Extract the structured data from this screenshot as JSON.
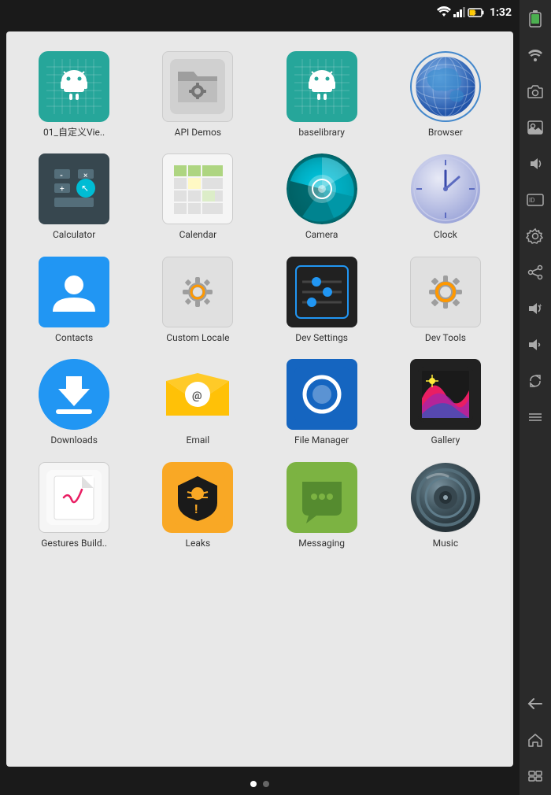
{
  "statusBar": {
    "time": "1:32",
    "wifiIcon": "wifi",
    "signalIcon": "signal",
    "batteryIcon": "battery"
  },
  "apps": [
    {
      "id": "app-01view",
      "label": "01_自定义Vie..",
      "iconType": "01view"
    },
    {
      "id": "app-api",
      "label": "API Demos",
      "iconType": "api"
    },
    {
      "id": "app-base",
      "label": "baselibrary",
      "iconType": "base"
    },
    {
      "id": "app-browser",
      "label": "Browser",
      "iconType": "browser"
    },
    {
      "id": "app-calculator",
      "label": "Calculator",
      "iconType": "calc"
    },
    {
      "id": "app-calendar",
      "label": "Calendar",
      "iconType": "calendar"
    },
    {
      "id": "app-camera",
      "label": "Camera",
      "iconType": "camera"
    },
    {
      "id": "app-clock",
      "label": "Clock",
      "iconType": "clock"
    },
    {
      "id": "app-contacts",
      "label": "Contacts",
      "iconType": "contacts"
    },
    {
      "id": "app-locale",
      "label": "Custom Locale",
      "iconType": "locale"
    },
    {
      "id": "app-devsettings",
      "label": "Dev Settings",
      "iconType": "devsettings"
    },
    {
      "id": "app-devtools",
      "label": "Dev Tools",
      "iconType": "devtools"
    },
    {
      "id": "app-downloads",
      "label": "Downloads",
      "iconType": "downloads"
    },
    {
      "id": "app-email",
      "label": "Email",
      "iconType": "email"
    },
    {
      "id": "app-filemanager",
      "label": "File Manager",
      "iconType": "filemanager"
    },
    {
      "id": "app-gallery",
      "label": "Gallery",
      "iconType": "gallery"
    },
    {
      "id": "app-gestures",
      "label": "Gestures Build..",
      "iconType": "gestures"
    },
    {
      "id": "app-leaks",
      "label": "Leaks",
      "iconType": "leaks"
    },
    {
      "id": "app-messaging",
      "label": "Messaging",
      "iconType": "messaging"
    },
    {
      "id": "app-music",
      "label": "Music",
      "iconType": "music"
    }
  ],
  "pageIndicators": [
    {
      "active": true
    },
    {
      "active": false
    }
  ],
  "sidebar": {
    "icons": [
      "battery-detail",
      "wifi-detail",
      "camera",
      "photo",
      "volume",
      "id-card",
      "settings-gear",
      "share",
      "volume-up",
      "volume-down",
      "rotate",
      "numbers",
      "back",
      "home",
      "menu"
    ]
  }
}
